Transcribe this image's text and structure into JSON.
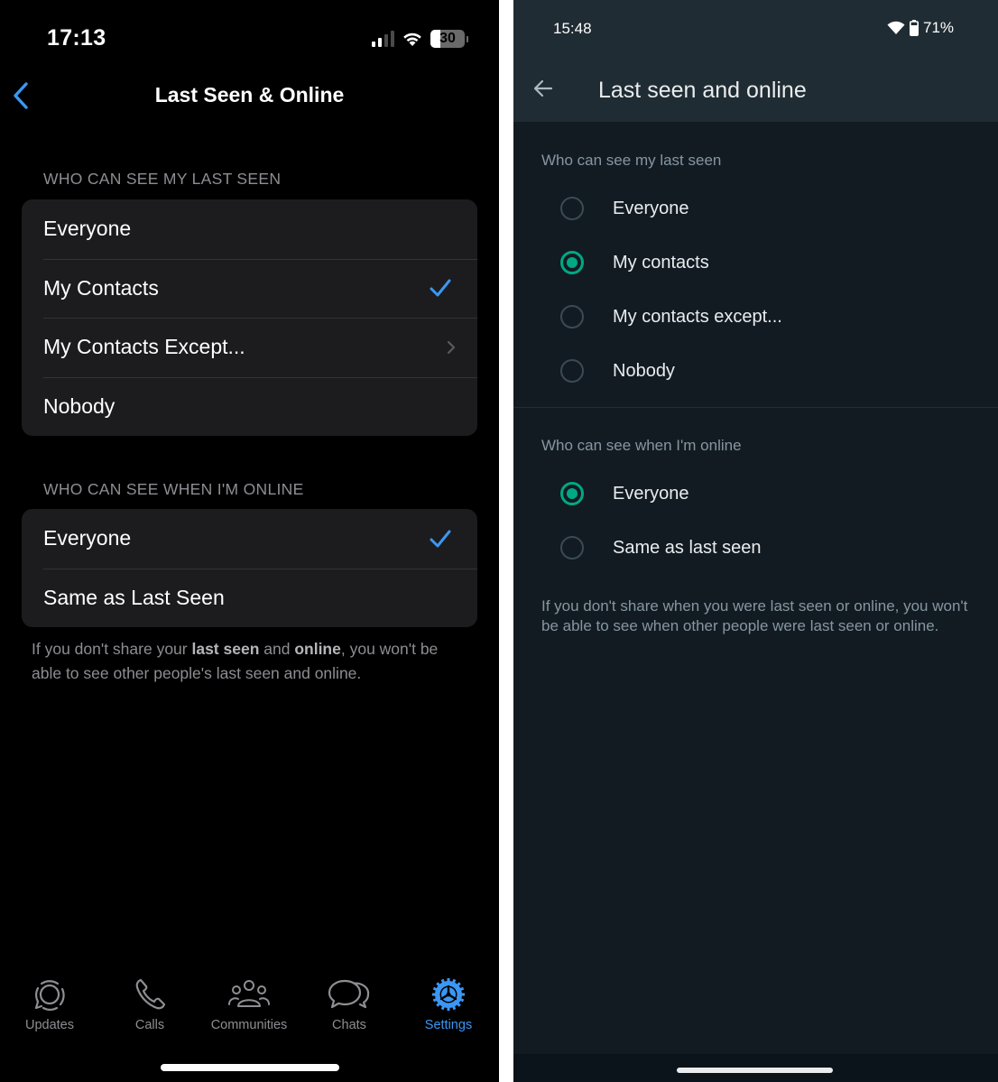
{
  "ios": {
    "status_bar": {
      "time": "17:13",
      "battery_percent": 30,
      "battery_label": "30",
      "signal_bars_active": 2,
      "signal_bars_total": 4,
      "icons": [
        "signal-icon",
        "wifi-icon",
        "battery-icon"
      ]
    },
    "nav": {
      "back_icon": "chevron-left-icon",
      "title": "Last Seen & Online"
    },
    "sections": [
      {
        "label": "WHO CAN SEE MY LAST SEEN",
        "options": [
          {
            "label": "Everyone",
            "selected": false,
            "accessory": "none"
          },
          {
            "label": "My Contacts",
            "selected": true,
            "accessory": "checkmark-icon"
          },
          {
            "label": "My Contacts Except...",
            "selected": false,
            "accessory": "chevron-right-icon"
          },
          {
            "label": "Nobody",
            "selected": false,
            "accessory": "none"
          }
        ]
      },
      {
        "label": "WHO CAN SEE WHEN I'M ONLINE",
        "options": [
          {
            "label": "Everyone",
            "selected": true,
            "accessory": "checkmark-icon"
          },
          {
            "label": "Same as Last Seen",
            "selected": false,
            "accessory": "none"
          }
        ]
      }
    ],
    "footnote": {
      "part1": "If you don't share your ",
      "bold1": "last seen",
      "part2": " and ",
      "bold2": "online",
      "part3": ", you won't be able to see other people's last seen and online."
    },
    "tabbar": {
      "tabs": [
        {
          "label": "Updates",
          "icon": "updates-icon",
          "active": false
        },
        {
          "label": "Calls",
          "icon": "phone-icon",
          "active": false
        },
        {
          "label": "Communities",
          "icon": "communities-icon",
          "active": false
        },
        {
          "label": "Chats",
          "icon": "chats-icon",
          "active": false
        },
        {
          "label": "Settings",
          "icon": "settings-gear-icon",
          "active": true
        }
      ]
    },
    "colors": {
      "accent": "#3b97f3",
      "background": "#000000",
      "card": "#1c1c1e",
      "secondary_text": "#8d8d93"
    }
  },
  "android": {
    "status_bar": {
      "time": "15:48",
      "battery": "71%",
      "icons": [
        "wifi-icon",
        "battery-icon"
      ]
    },
    "header": {
      "back_icon": "arrow-left-icon",
      "title": "Last seen and online"
    },
    "sections": [
      {
        "label": "Who can see my last seen",
        "options": [
          {
            "label": "Everyone",
            "selected": false
          },
          {
            "label": "My contacts",
            "selected": true
          },
          {
            "label": "My contacts except...",
            "selected": false
          },
          {
            "label": "Nobody",
            "selected": false
          }
        ]
      },
      {
        "label": "Who can see when I'm online",
        "options": [
          {
            "label": "Everyone",
            "selected": true
          },
          {
            "label": "Same as last seen",
            "selected": false
          }
        ]
      }
    ],
    "footnote": "If you don't share when you were last seen or online, you won't be able to see when other people were last seen or online.",
    "colors": {
      "accent": "#00a884",
      "background": "#121b22",
      "header": "#202c33",
      "secondary_text": "#8696a0"
    }
  }
}
